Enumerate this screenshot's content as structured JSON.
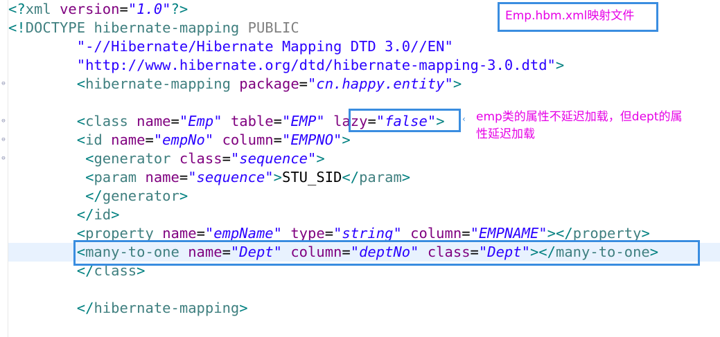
{
  "editor": {
    "lines": [
      [
        {
          "c": "p",
          "t": "<?"
        },
        {
          "c": "t",
          "t": "xml"
        },
        {
          "c": "x",
          "t": " "
        },
        {
          "c": "a",
          "t": "version"
        },
        {
          "c": "x",
          "t": "="
        },
        {
          "c": "v",
          "t": "\"1.0\""
        },
        {
          "c": "p",
          "t": "?>"
        }
      ],
      [
        {
          "c": "p",
          "t": "<!"
        },
        {
          "c": "t",
          "t": "DOCTYPE"
        },
        {
          "c": "x",
          "t": " "
        },
        {
          "c": "t",
          "t": "hibernate-mapping"
        },
        {
          "c": "x",
          "t": " "
        },
        {
          "c": "dt",
          "t": "PUBLIC"
        }
      ],
      [
        {
          "c": "x",
          "t": "        "
        },
        {
          "c": "s",
          "t": "\"-//Hibernate/Hibernate Mapping DTD 3.0//EN\""
        }
      ],
      [
        {
          "c": "x",
          "t": "        "
        },
        {
          "c": "s",
          "t": "\"http://www.hibernate.org/dtd/hibernate-mapping-3.0.dtd\""
        },
        {
          "c": "p",
          "t": ">"
        }
      ],
      [
        {
          "c": "x",
          "t": "        "
        },
        {
          "c": "p",
          "t": "<"
        },
        {
          "c": "t",
          "t": "hibernate-mapping"
        },
        {
          "c": "x",
          "t": " "
        },
        {
          "c": "a",
          "t": "package"
        },
        {
          "c": "x",
          "t": "="
        },
        {
          "c": "v",
          "t": "\"cn.happy.entity\""
        },
        {
          "c": "p",
          "t": ">"
        }
      ],
      [],
      [
        {
          "c": "x",
          "t": "        "
        },
        {
          "c": "p",
          "t": "<"
        },
        {
          "c": "t",
          "t": "class"
        },
        {
          "c": "x",
          "t": " "
        },
        {
          "c": "a",
          "t": "name"
        },
        {
          "c": "x",
          "t": "="
        },
        {
          "c": "v",
          "t": "\"Emp\""
        },
        {
          "c": "x",
          "t": " "
        },
        {
          "c": "a",
          "t": "table"
        },
        {
          "c": "x",
          "t": "="
        },
        {
          "c": "v",
          "t": "\"EMP\""
        },
        {
          "c": "x",
          "t": " "
        },
        {
          "c": "a",
          "t": "lazy"
        },
        {
          "c": "x",
          "t": "="
        },
        {
          "c": "v",
          "t": "\"false\""
        },
        {
          "c": "p",
          "t": ">"
        }
      ],
      [
        {
          "c": "x",
          "t": "        "
        },
        {
          "c": "p",
          "t": "<"
        },
        {
          "c": "t",
          "t": "id"
        },
        {
          "c": "x",
          "t": " "
        },
        {
          "c": "a",
          "t": "name"
        },
        {
          "c": "x",
          "t": "="
        },
        {
          "c": "v",
          "t": "\"empNo\""
        },
        {
          "c": "x",
          "t": " "
        },
        {
          "c": "a",
          "t": "column"
        },
        {
          "c": "x",
          "t": "="
        },
        {
          "c": "v",
          "t": "\"EMPNO\""
        },
        {
          "c": "p",
          "t": ">"
        }
      ],
      [
        {
          "c": "x",
          "t": "         "
        },
        {
          "c": "p",
          "t": "<"
        },
        {
          "c": "t",
          "t": "generator"
        },
        {
          "c": "x",
          "t": " "
        },
        {
          "c": "a",
          "t": "class"
        },
        {
          "c": "x",
          "t": "="
        },
        {
          "c": "v",
          "t": "\"sequence\""
        },
        {
          "c": "p",
          "t": ">"
        }
      ],
      [
        {
          "c": "x",
          "t": "         "
        },
        {
          "c": "p",
          "t": "<"
        },
        {
          "c": "t",
          "t": "param"
        },
        {
          "c": "x",
          "t": " "
        },
        {
          "c": "a",
          "t": "name"
        },
        {
          "c": "x",
          "t": "="
        },
        {
          "c": "v",
          "t": "\"sequence\""
        },
        {
          "c": "p",
          "t": ">"
        },
        {
          "c": "x",
          "t": "STU_SID"
        },
        {
          "c": "p",
          "t": "</"
        },
        {
          "c": "t",
          "t": "param"
        },
        {
          "c": "p",
          "t": ">"
        }
      ],
      [
        {
          "c": "x",
          "t": "         "
        },
        {
          "c": "p",
          "t": "</"
        },
        {
          "c": "t",
          "t": "generator"
        },
        {
          "c": "p",
          "t": ">"
        }
      ],
      [
        {
          "c": "x",
          "t": "        "
        },
        {
          "c": "p",
          "t": "</"
        },
        {
          "c": "t",
          "t": "id"
        },
        {
          "c": "p",
          "t": ">"
        }
      ],
      [
        {
          "c": "x",
          "t": "        "
        },
        {
          "c": "p",
          "t": "<"
        },
        {
          "c": "t",
          "t": "property"
        },
        {
          "c": "x",
          "t": " "
        },
        {
          "c": "a",
          "t": "name"
        },
        {
          "c": "x",
          "t": "="
        },
        {
          "c": "v",
          "t": "\"empName\""
        },
        {
          "c": "x",
          "t": " "
        },
        {
          "c": "a",
          "t": "type"
        },
        {
          "c": "x",
          "t": "="
        },
        {
          "c": "v",
          "t": "\"string\""
        },
        {
          "c": "x",
          "t": " "
        },
        {
          "c": "a",
          "t": "column"
        },
        {
          "c": "x",
          "t": "="
        },
        {
          "c": "v",
          "t": "\"EMPNAME\""
        },
        {
          "c": "p",
          "t": "></"
        },
        {
          "c": "t",
          "t": "property"
        },
        {
          "c": "p",
          "t": ">"
        }
      ],
      [
        {
          "c": "x",
          "t": "        "
        },
        {
          "c": "p",
          "t": "<"
        },
        {
          "c": "t",
          "t": "many-to-one"
        },
        {
          "c": "x",
          "t": " "
        },
        {
          "c": "a",
          "t": "name"
        },
        {
          "c": "x",
          "t": "="
        },
        {
          "c": "v",
          "t": "\"Dept\""
        },
        {
          "c": "x",
          "t": " "
        },
        {
          "c": "a",
          "t": "column"
        },
        {
          "c": "x",
          "t": "="
        },
        {
          "c": "v",
          "t": "\"deptNo\""
        },
        {
          "c": "x",
          "t": " "
        },
        {
          "c": "a",
          "t": "class"
        },
        {
          "c": "x",
          "t": "="
        },
        {
          "c": "v",
          "t": "\"Dept\""
        },
        {
          "c": "p",
          "t": "></"
        },
        {
          "c": "t",
          "t": "many-to-one"
        },
        {
          "c": "p",
          "t": ">"
        }
      ],
      [
        {
          "c": "x",
          "t": "        "
        },
        {
          "c": "p",
          "t": "</"
        },
        {
          "c": "t",
          "t": "class"
        },
        {
          "c": "p",
          "t": ">"
        }
      ],
      [],
      [
        {
          "c": "x",
          "t": "        "
        },
        {
          "c": "p",
          "t": "</"
        },
        {
          "c": "t",
          "t": "hibernate-mapping"
        },
        {
          "c": "p",
          "t": ">"
        }
      ]
    ]
  },
  "annotations": {
    "file_label": "Emp.hbm.xml映射文件",
    "lazy_note_line1": "emp类的属性不延迟加载，但dept的属",
    "lazy_note_line2": "性延迟加载"
  },
  "icons": {
    "fold_marker": "collapse-icon"
  },
  "colors": {
    "highlight_box": "#3a8de0",
    "note_text": "#e600e6",
    "current_line": "#e8f2fe"
  }
}
